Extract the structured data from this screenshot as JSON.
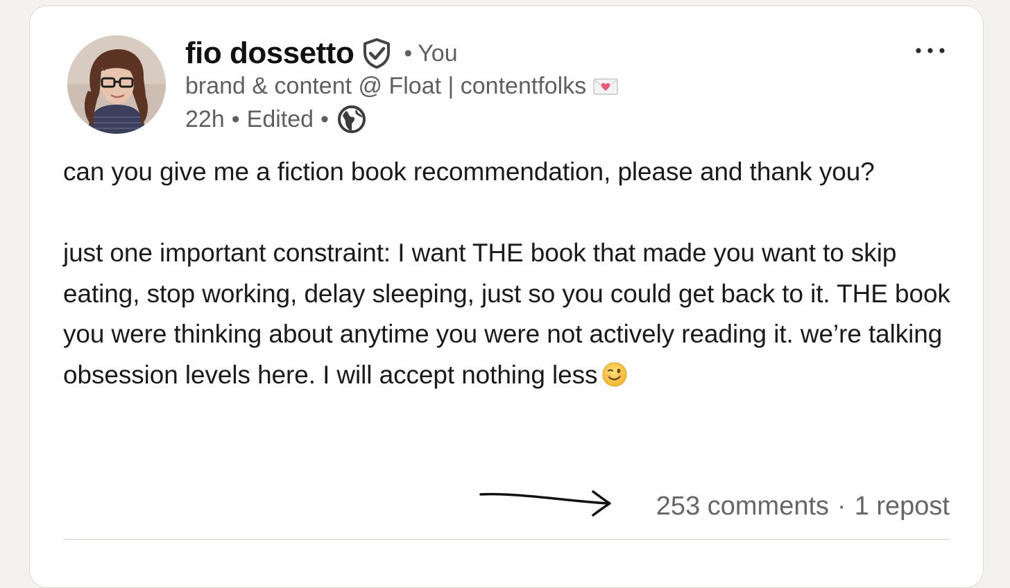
{
  "author": {
    "name": "fio dossetto",
    "verified_icon": "shield-check-icon",
    "degree": "You",
    "headline": "brand & content @ Float | contentfolks",
    "headline_icon": "love-letter-icon",
    "time": "22h",
    "edited": "Edited",
    "visibility_icon": "globe-icon"
  },
  "post": {
    "paragraph1": "can you give me a fiction book recommendation, please and thank you?",
    "paragraph2": "just one important constraint: I want THE book that made you want to skip eating, stop working, delay sleeping, just so you could get back to it. THE book you were thinking about anytime you were not actively reading it. we’re talking obsession levels here. I will accept nothing less",
    "emoji_icon": "winking-face-icon"
  },
  "social": {
    "comments": "253 comments",
    "reposts": "1 repost"
  },
  "colors": {
    "background": "#f3f2ef",
    "card": "#ffffff",
    "text": "#1a1a1a",
    "muted": "#5f5f5f"
  }
}
